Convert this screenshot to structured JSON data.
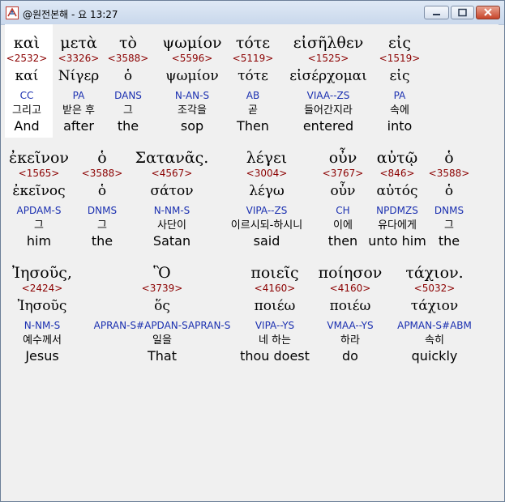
{
  "window": {
    "title": "@원전본해 - 요 13:27",
    "buttons": {
      "minimize": "minimize",
      "maximize": "maximize",
      "close": "close"
    }
  },
  "rows": [
    {
      "words": [
        {
          "greek": "καὶ",
          "strong": "<2532>",
          "lemma": "καί",
          "morph": "CC",
          "korean": "그리고",
          "english": "And"
        },
        {
          "greek": "μετὰ",
          "strong": "<3326>",
          "lemma": "Νίγερ",
          "morph": "PA",
          "korean": "받은 후",
          "english": "after"
        },
        {
          "greek": "τὸ",
          "strong": "<3588>",
          "lemma": "ὁ",
          "morph": "DANS",
          "korean": "그",
          "english": "the"
        },
        {
          "greek": "ψωμίον",
          "strong": "<5596>",
          "lemma": "ψωμίον",
          "morph": "N-AN-S",
          "korean": "조각을",
          "english": "sop"
        },
        {
          "greek": "τότε",
          "strong": "<5119>",
          "lemma": "τότε",
          "morph": "AB",
          "korean": "곧",
          "english": "Then"
        },
        {
          "greek": "εἰσῆλθεν",
          "strong": "<1525>",
          "lemma": "εἰσέρχομαι",
          "morph": "VIAA--ZS",
          "korean": "들어간지라",
          "english": "entered"
        },
        {
          "greek": "εἰς",
          "strong": "<1519>",
          "lemma": "εἰς",
          "morph": "PA",
          "korean": "속에",
          "english": "into"
        }
      ]
    },
    {
      "words": [
        {
          "greek": "ἐκεῖνον",
          "strong": "<1565>",
          "lemma": "ἐκεῖνος",
          "morph": "APDAM-S",
          "korean": "그",
          "english": "him"
        },
        {
          "greek": "ὁ",
          "strong": "<3588>",
          "lemma": "ὁ",
          "morph": "DNMS",
          "korean": "그",
          "english": "the"
        },
        {
          "greek": "Σατανᾶς.",
          "strong": "<4567>",
          "lemma": "σάτον",
          "morph": "N-NM-S",
          "korean": "사단이",
          "english": "Satan"
        },
        {
          "greek": "λέγει",
          "strong": "<3004>",
          "lemma": "λέγω",
          "morph": "VIPA--ZS",
          "korean": "이르시되-하시니",
          "english": "said"
        },
        {
          "greek": "οὖν",
          "strong": "<3767>",
          "lemma": "οὖν",
          "morph": "CH",
          "korean": "이에",
          "english": "then"
        },
        {
          "greek": "αὐτῷ",
          "strong": "<846>",
          "lemma": "αὐτός",
          "morph": "NPDMZS",
          "korean": "유다에게",
          "english": "unto him"
        },
        {
          "greek": "ὁ",
          "strong": "<3588>",
          "lemma": "ὁ",
          "morph": "DNMS",
          "korean": "그",
          "english": "the"
        }
      ]
    },
    {
      "words": [
        {
          "greek": "Ἰησοῦς,",
          "strong": "<2424>",
          "lemma": "Ἰησοῦς",
          "morph": "N-NM-S",
          "korean": "예수께서",
          "english": "Jesus"
        },
        {
          "greek": "Ὃ",
          "strong": "<3739>",
          "lemma": "ὅς",
          "morph": "APRAN-S#APDAN-SAPRAN-S",
          "korean": "일을",
          "english": "That"
        },
        {
          "greek": "ποιεῖς",
          "strong": "<4160>",
          "lemma": "ποιέω",
          "morph": "VIPA--YS",
          "korean": "네 하는",
          "english": "thou doest"
        },
        {
          "greek": "ποίησον",
          "strong": "<4160>",
          "lemma": "ποιέω",
          "morph": "VMAA--YS",
          "korean": "하라",
          "english": "do"
        },
        {
          "greek": "τάχιον.",
          "strong": "<5032>",
          "lemma": "τάχιον",
          "morph": "APMAN-S#ABM",
          "korean": "속히",
          "english": "quickly"
        }
      ]
    }
  ]
}
